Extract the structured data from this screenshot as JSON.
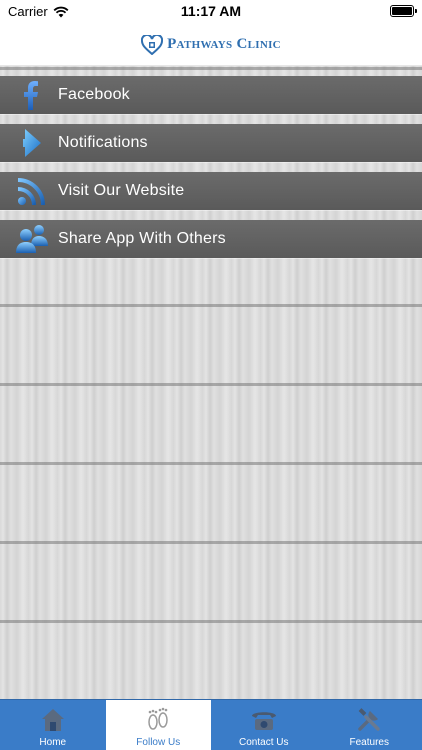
{
  "status_bar": {
    "carrier": "Carrier",
    "time": "11:17 AM"
  },
  "header": {
    "logo_text": "Pathways Clinic"
  },
  "menu": {
    "items": [
      {
        "label": "Facebook",
        "icon": "facebook-icon"
      },
      {
        "label": "Notifications",
        "icon": "megaphone-icon"
      },
      {
        "label": "Visit Our Website",
        "icon": "rss-icon"
      },
      {
        "label": "Share App With Others",
        "icon": "people-icon"
      }
    ]
  },
  "tabbar": {
    "tabs": [
      {
        "label": "Home",
        "icon": "house-icon",
        "active": false
      },
      {
        "label": "Follow Us",
        "icon": "footprints-icon",
        "active": true
      },
      {
        "label": "Contact Us",
        "icon": "telephone-icon",
        "active": false
      },
      {
        "label": "Features",
        "icon": "tools-icon",
        "active": false
      }
    ]
  },
  "colors": {
    "brand_blue": "#3a7cc8",
    "menu_bar": "#5f5f5f",
    "logo_blue": "#2f6fb0"
  }
}
